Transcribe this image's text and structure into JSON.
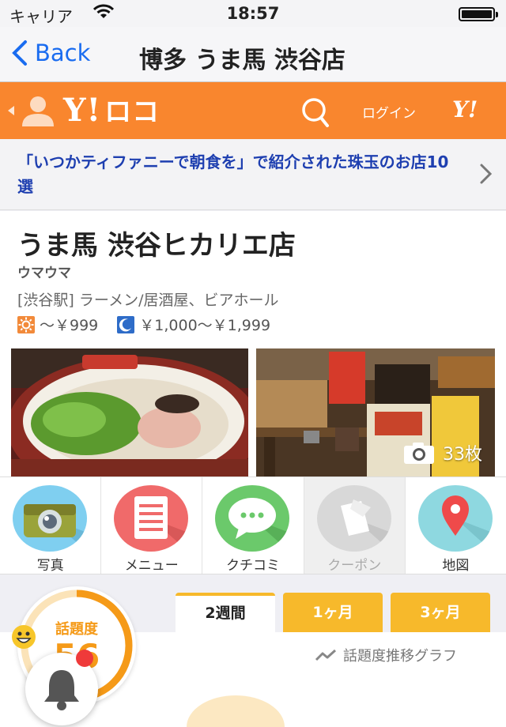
{
  "status_bar": {
    "carrier": "キャリア",
    "time": "18:57"
  },
  "nav": {
    "back_label": "Back",
    "title": "博多 うま馬 渋谷店"
  },
  "header": {
    "logo_text": "Y!",
    "logo_suffix": "ロコ",
    "login_label": "ログイン",
    "y_mark": "Y!"
  },
  "banner": {
    "text": "「いつかティファニーで朝食を」で紹介された珠玉のお店10選"
  },
  "shop": {
    "name": "うま馬 渋谷ヒカリエ店",
    "kana": "ウマウマ",
    "genre": "[渋谷駅]  ラーメン/居酒屋、ビアホール",
    "lunch_budget": "〜￥999",
    "dinner_budget": "￥1,000〜￥1,999"
  },
  "photos": {
    "count_label": "33枚"
  },
  "menu": {
    "items": [
      {
        "label": "写真",
        "icon": "camera-icon",
        "color": "#7fcff0"
      },
      {
        "label": "メニュー",
        "icon": "menu-list-icon",
        "color": "#f06a6a"
      },
      {
        "label": "クチコミ",
        "icon": "speech-bubble-icon",
        "color": "#6bc96b"
      },
      {
        "label": "クーポン",
        "icon": "coupon-icon",
        "color": "#d8d8d8"
      },
      {
        "label": "地図",
        "icon": "map-pin-icon",
        "color": "#8ed8e0"
      }
    ]
  },
  "trend": {
    "label": "話題度",
    "value": "56",
    "tabs": [
      "2週間",
      "1ヶ月",
      "3ヶ月"
    ],
    "graph_link": "話題度推移グラフ"
  },
  "colors": {
    "accent": "#f9862e",
    "link": "#1a6cf0",
    "tab": "#f7b92b",
    "gauge": "#f59a18"
  }
}
